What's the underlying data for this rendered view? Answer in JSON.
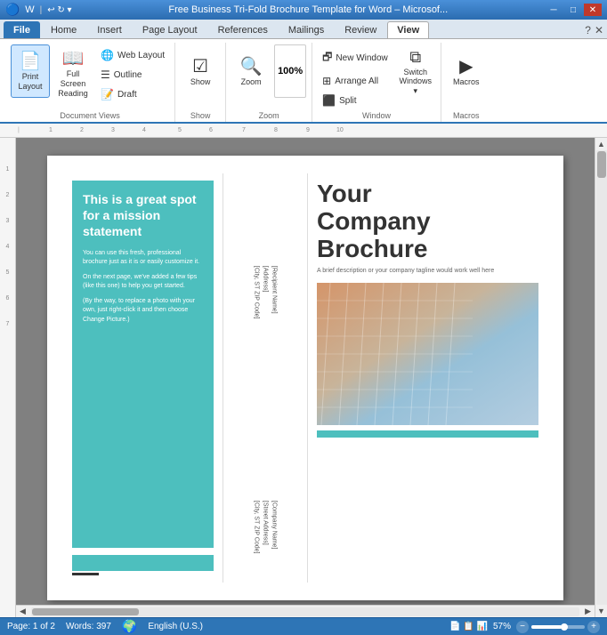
{
  "titleBar": {
    "title": "Free Business Tri-Fold Brochure Template for Word – Microsof...",
    "minBtn": "─",
    "maxBtn": "□",
    "closeBtn": "✕"
  },
  "tabs": [
    {
      "id": "file",
      "label": "File",
      "active": false,
      "isFile": true
    },
    {
      "id": "home",
      "label": "Home",
      "active": false
    },
    {
      "id": "insert",
      "label": "Insert",
      "active": false
    },
    {
      "id": "page-layout",
      "label": "Page Layout",
      "active": false
    },
    {
      "id": "references",
      "label": "References",
      "active": false
    },
    {
      "id": "mailings",
      "label": "Mailings",
      "active": false
    },
    {
      "id": "review",
      "label": "Review",
      "active": false
    },
    {
      "id": "view",
      "label": "View",
      "active": true
    }
  ],
  "ribbon": {
    "groups": [
      {
        "id": "document-views",
        "label": "Document Views",
        "buttons": [
          {
            "id": "print-layout",
            "label": "Print\nLayout",
            "icon": "📄",
            "active": true
          },
          {
            "id": "full-screen",
            "label": "Full Screen\nReading",
            "icon": "📖",
            "active": false
          }
        ],
        "smallButtons": [
          {
            "id": "web-layout",
            "label": "Web Layout",
            "icon": "🌐"
          },
          {
            "id": "outline",
            "label": "Outline",
            "icon": "☰"
          },
          {
            "id": "draft",
            "label": "Draft",
            "icon": "📝"
          }
        ]
      },
      {
        "id": "show",
        "label": "Show",
        "buttons": [
          {
            "id": "show",
            "label": "Show",
            "icon": "☑"
          }
        ]
      },
      {
        "id": "zoom",
        "label": "Zoom",
        "buttons": [
          {
            "id": "zoom",
            "label": "Zoom",
            "icon": "🔍"
          },
          {
            "id": "zoom-100",
            "label": "100%",
            "icon": "100"
          }
        ]
      },
      {
        "id": "window",
        "label": "Window",
        "buttons": [
          {
            "id": "new-window",
            "label": "New Window",
            "icon": "🗗"
          },
          {
            "id": "arrange-all",
            "label": "Arrange All",
            "icon": "⊞"
          },
          {
            "id": "split",
            "label": "Split",
            "icon": "⬜"
          },
          {
            "id": "switch-windows",
            "label": "Switch\nWindows",
            "icon": "⧉"
          }
        ]
      },
      {
        "id": "macros",
        "label": "Macros",
        "buttons": [
          {
            "id": "macros",
            "label": "Macros",
            "icon": "▶"
          }
        ]
      }
    ]
  },
  "document": {
    "leftPanel": {
      "title": "This is a great spot for a mission statement",
      "paragraphs": [
        "You can use this fresh, professional brochure just as it is or easily customize it.",
        "On the next page, we've added a few tips (like this one) to help you get started.",
        "(By the way, to replace a photo with your own, just right-click it and then choose Change Picture.)"
      ]
    },
    "middlePanel": {
      "toAddress": "[Recipient Name]\n[Address]\n[City, ST ZIP Code]",
      "fromAddress": "[Company Name]\n[Street Address]\n[City, ST ZIP Code]"
    },
    "rightPanel": {
      "companyTitle": "Your\nCompany\nBrochure",
      "tagline": "A brief description or your company tagline\nwould work well here"
    }
  },
  "statusBar": {
    "page": "Page: 1 of 2",
    "words": "Words: 397",
    "language": "English (U.S.)",
    "zoom": "57%"
  }
}
